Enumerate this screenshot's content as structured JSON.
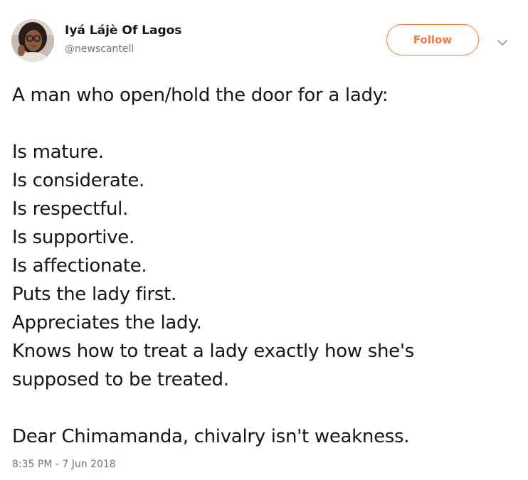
{
  "user": {
    "display_name": "Iyá Lájè Of Lagos",
    "handle": "@newscantell"
  },
  "follow_button": {
    "label": "Follow"
  },
  "tweet": {
    "lines": [
      "A man who open/hold the door for a lady:",
      "",
      "Is mature.",
      "Is considerate.",
      "Is respectful.",
      "Is supportive.",
      "Is affectionate.",
      "Puts the lady first.",
      "Appreciates the lady.",
      "Knows how to treat a lady exactly how she's",
      "supposed to be treated.",
      "",
      "Dear Chimamanda, chivalry isn't weakness."
    ],
    "timestamp": "8:35 PM - 7 Jun 2018"
  },
  "icons": {
    "more": "chevron-down-icon",
    "avatar": "profile-photo"
  },
  "colors": {
    "accent": "#f47b3f",
    "text": "#14171a",
    "secondary": "#657786"
  }
}
